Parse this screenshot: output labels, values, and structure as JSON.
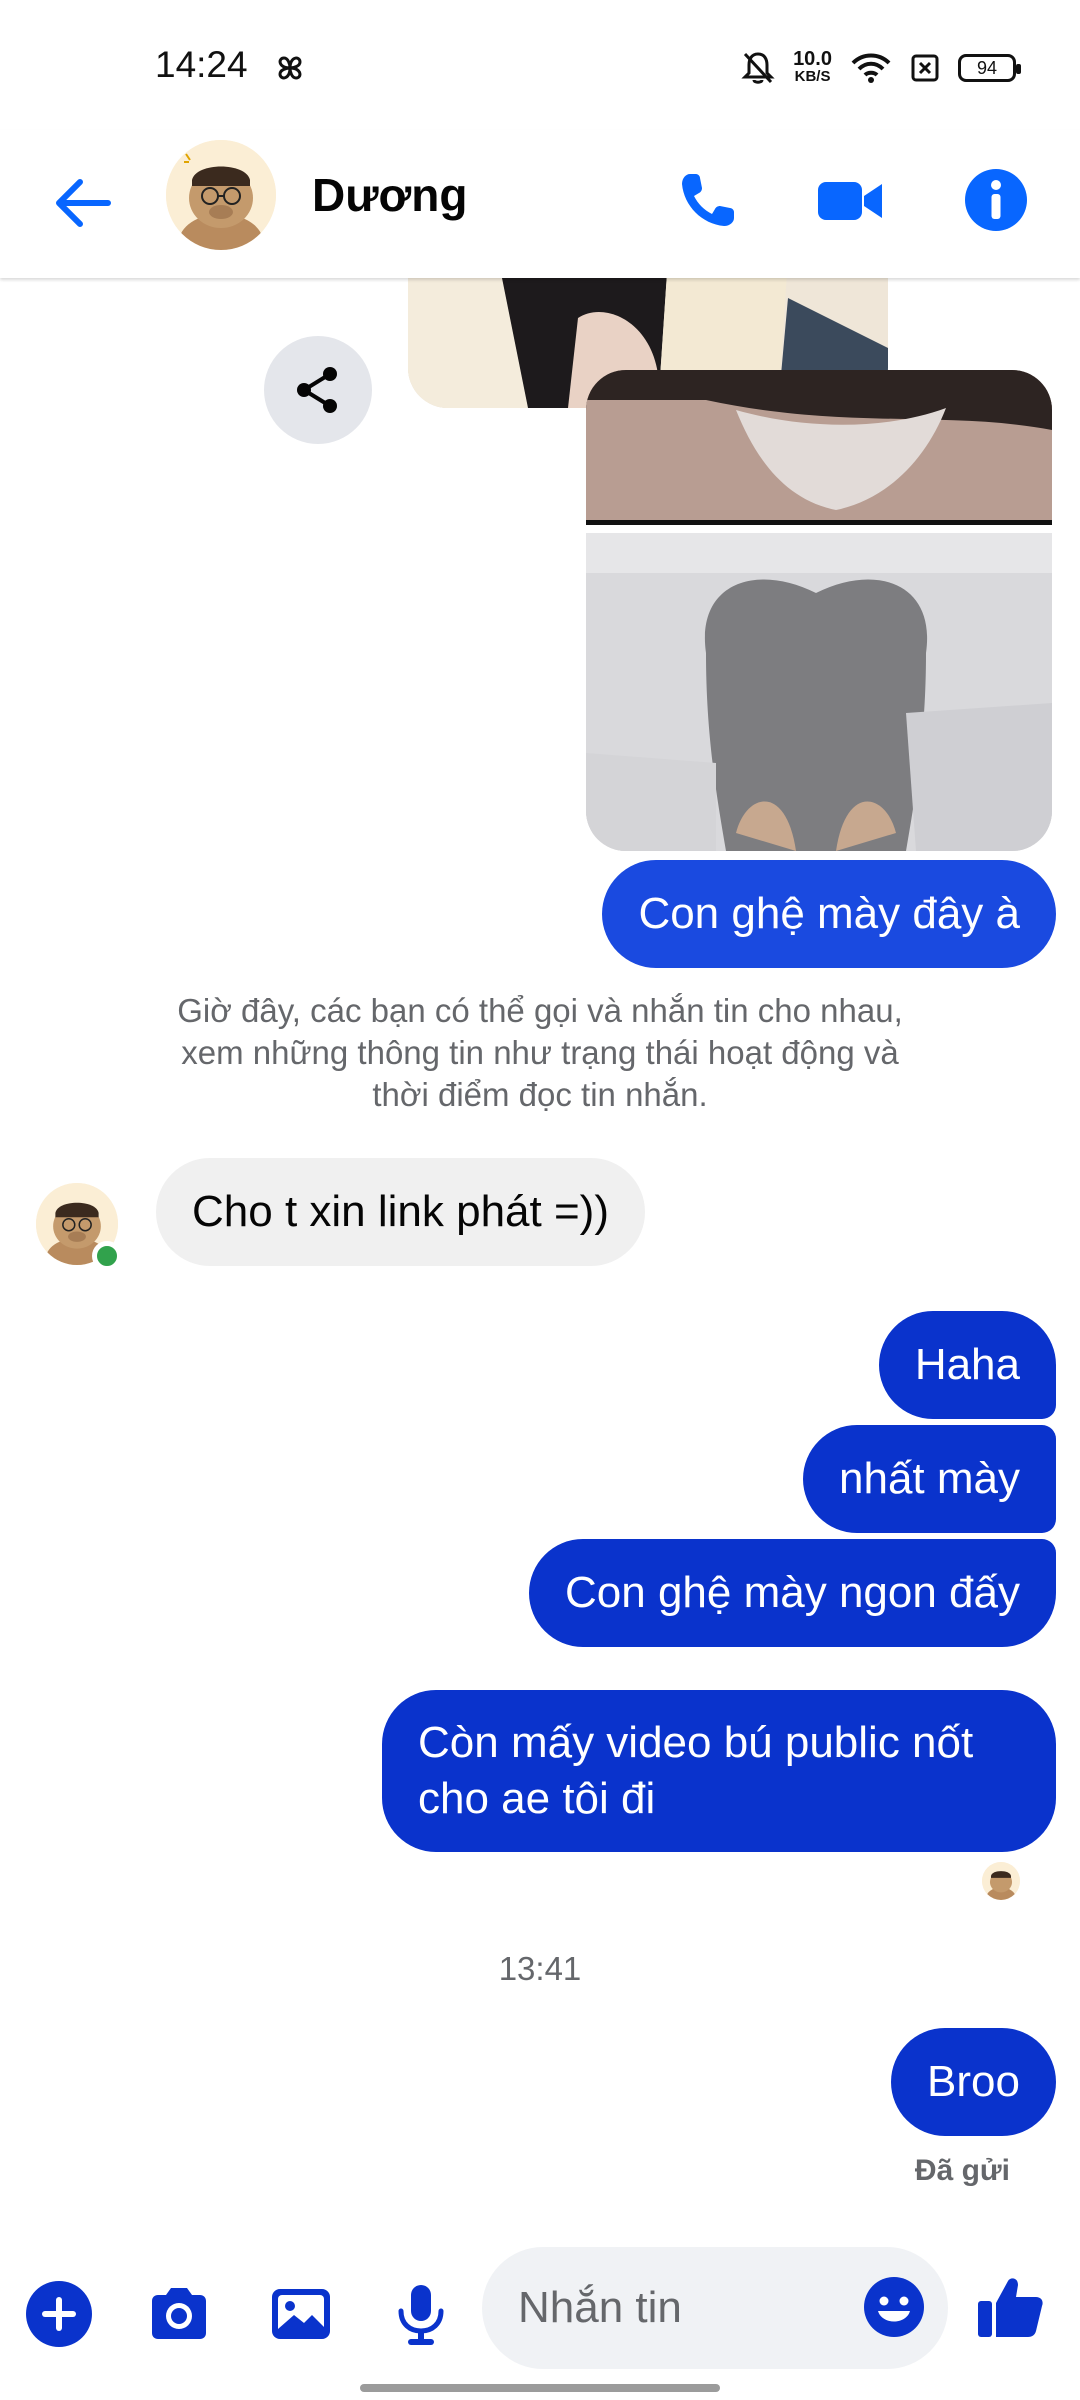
{
  "status_bar": {
    "time": "14:24",
    "net_speed_value": "10.0",
    "net_speed_unit": "KB/S",
    "battery": "94"
  },
  "header": {
    "contact_name": "Dương"
  },
  "messages": {
    "outgoing_1": "Con ghệ mày đây à",
    "notice": "Giờ đây, các bạn có thể gọi và nhắn tin cho nhau, xem những thông tin như trạng thái hoạt động và thời điểm đọc tin nhắn.",
    "incoming_1": "Cho t xin link phát =))",
    "outgoing_2": "Haha",
    "outgoing_3": "nhất mày",
    "outgoing_4": "Con ghệ mày ngon đấy",
    "outgoing_5": "Còn mấy video bú public nốt cho ae tôi đi",
    "time_separator": "13:41",
    "outgoing_6": "Broo",
    "sent_status": "Đã gửi"
  },
  "composer": {
    "placeholder": "Nhắn tin"
  },
  "colors": {
    "accent": "#0866ff",
    "outgoing_bubble": "#0a33cc",
    "incoming_bubble": "#f0f0f0",
    "online": "#31a24c"
  },
  "icons": [
    "back-arrow-icon",
    "phone-icon",
    "video-camera-icon",
    "info-icon",
    "share-icon",
    "plus-icon",
    "camera-icon",
    "gallery-icon",
    "microphone-icon",
    "emoji-icon",
    "thumbs-up-icon"
  ]
}
